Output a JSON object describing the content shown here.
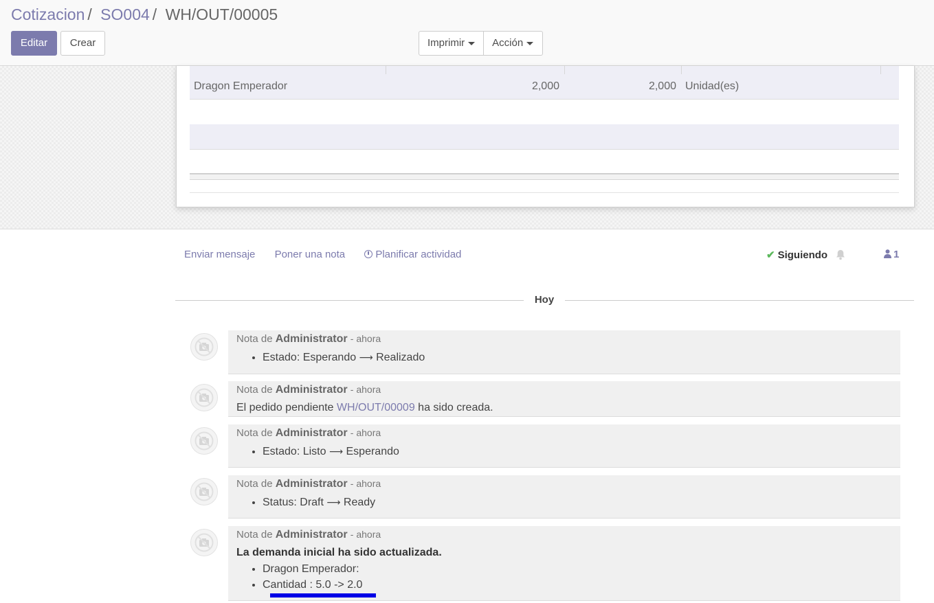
{
  "breadcrumb": {
    "items": [
      "Cotizacion",
      "SO004",
      "WH/OUT/00005"
    ],
    "separator": "/"
  },
  "buttons": {
    "edit": "Editar",
    "create": "Crear",
    "print": "Imprimir",
    "action": "Acción"
  },
  "table": {
    "rows": [
      {
        "product": "Dragon Emperador",
        "demand": "2,000",
        "done": "2,000",
        "uom": "Unidad(es)"
      }
    ]
  },
  "chatter": {
    "send_message": "Enviar mensaje",
    "log_note": "Poner una nota",
    "schedule_activity": "Planificar actividad",
    "following": "Siguiendo",
    "followers_count": "1",
    "date_separator": "Hoy",
    "messages": [
      {
        "prefix": "Nota de",
        "author": "Administrator",
        "date": "- ahora",
        "items": [
          {
            "field": "Estado:",
            "old": "Esperando",
            "new": "Realizado"
          }
        ]
      },
      {
        "prefix": "Nota de",
        "author": "Administrator",
        "date": "- ahora",
        "body_pre": "El pedido pendiente",
        "link": "WH/OUT/00009",
        "body_post": "ha sido creada."
      },
      {
        "prefix": "Nota de",
        "author": "Administrator",
        "date": "- ahora",
        "items": [
          {
            "field": "Estado:",
            "old": "Listo",
            "new": "Esperando"
          }
        ]
      },
      {
        "prefix": "Nota de",
        "author": "Administrator",
        "date": "- ahora",
        "items": [
          {
            "field": "Status:",
            "old": "Draft",
            "new": "Ready"
          }
        ]
      },
      {
        "prefix": "Nota de",
        "author": "Administrator",
        "date": "- ahora",
        "title": "La demanda inicial ha sido actualizada.",
        "lines": [
          "Dragon Emperador:",
          "Cantidad : 5.0 -> 2.0"
        ]
      }
    ]
  },
  "colors": {
    "brand": "#7c7bad",
    "highlight": "#0000e6",
    "check": "#5cb85c"
  }
}
